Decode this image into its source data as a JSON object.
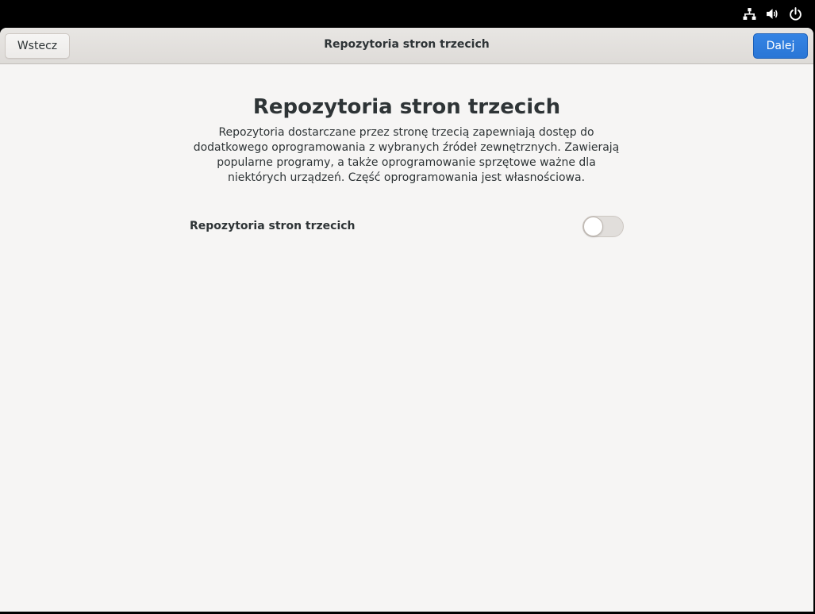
{
  "tray": {
    "icons": [
      "network-wired-icon",
      "volume-icon",
      "power-icon"
    ]
  },
  "headerbar": {
    "back_label": "Wstecz",
    "title": "Repozytoria stron trzecich",
    "next_label": "Dalej"
  },
  "page": {
    "title": "Repozytoria stron trzecich",
    "description": "Repozytoria dostarczane przez stronę trzecią zapewniają dostęp do dodatkowego oprogramowania z wybranych źródeł zewnętrznych. Zawierają popularne programy, a także oprogramowanie sprzętowe ważne dla niektórych urządzeń. Część oprogramowania jest własnościowa.",
    "toggle_row": {
      "label": "Repozytoria stron trzecich",
      "enabled": false
    }
  },
  "colors": {
    "accent": "#3584e4",
    "window_bg": "#f6f5f4",
    "text": "#2e3436",
    "topbar": "#000000"
  }
}
